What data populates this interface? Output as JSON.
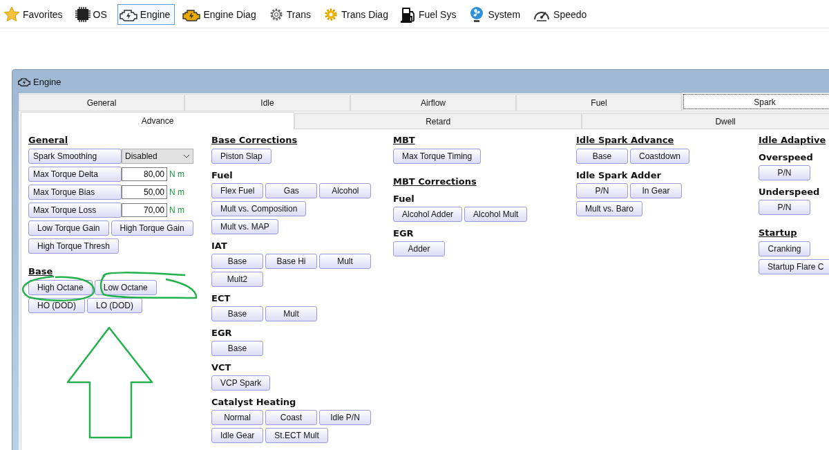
{
  "toolbar": [
    {
      "label": "Favorites",
      "selected": false
    },
    {
      "label": "OS",
      "selected": false
    },
    {
      "label": "Engine",
      "selected": true
    },
    {
      "label": "Engine Diag",
      "selected": false
    },
    {
      "label": "Trans",
      "selected": false
    },
    {
      "label": "Trans Diag",
      "selected": false
    },
    {
      "label": "Fuel Sys",
      "selected": false
    },
    {
      "label": "System",
      "selected": false
    },
    {
      "label": "Speedo",
      "selected": false
    }
  ],
  "window": {
    "title": "Engine"
  },
  "tabs": [
    {
      "label": "General",
      "selected": false
    },
    {
      "label": "Idle",
      "selected": false
    },
    {
      "label": "Airflow",
      "selected": false
    },
    {
      "label": "Fuel",
      "selected": false
    },
    {
      "label": "Spark",
      "selected": true
    }
  ],
  "subtabs": [
    {
      "label": "Advance",
      "selected": true
    },
    {
      "label": "Retard",
      "selected": false
    },
    {
      "label": "Dwell",
      "selected": false
    }
  ],
  "columns": [
    [
      {
        "kind": "section",
        "text": "General"
      },
      {
        "kind": "dropdown",
        "label": "Spark Smoothing",
        "value": "Disabled"
      },
      {
        "kind": "param",
        "label": "Max Torque Delta",
        "value": "80,00",
        "unit": "N m"
      },
      {
        "kind": "param",
        "label": "Max Torque Bias",
        "value": "50,00",
        "unit": "N m"
      },
      {
        "kind": "param",
        "label": "Max Torque Loss",
        "value": "70,00",
        "unit": "N m"
      },
      {
        "kind": "buttons",
        "labels": [
          "Low Torque Gain",
          "High Torque Gain"
        ]
      },
      {
        "kind": "buttons",
        "labels": [
          "High Torque Thresh"
        ]
      },
      {
        "kind": "section",
        "text": "Base"
      },
      {
        "kind": "buttons",
        "labels": [
          "High Octane",
          "Low Octane"
        ]
      },
      {
        "kind": "buttons",
        "labels": [
          "HO (DOD)",
          "LO (DOD)"
        ]
      }
    ],
    [
      {
        "kind": "section",
        "text": "Base Corrections"
      },
      {
        "kind": "buttons",
        "labels": [
          "Piston Slap"
        ]
      },
      {
        "kind": "group",
        "text": "Fuel"
      },
      {
        "kind": "buttons",
        "labels": [
          "Flex Fuel",
          "Gas",
          "Alcohol"
        ]
      },
      {
        "kind": "buttons",
        "labels": [
          "Mult vs. Composition"
        ]
      },
      {
        "kind": "buttons",
        "labels": [
          "Mult vs. MAP"
        ]
      },
      {
        "kind": "group",
        "text": "IAT"
      },
      {
        "kind": "buttons",
        "labels": [
          "Base",
          "Base Hi",
          "Mult"
        ]
      },
      {
        "kind": "buttons",
        "labels": [
          "Mult2"
        ]
      },
      {
        "kind": "group",
        "text": "ECT"
      },
      {
        "kind": "buttons",
        "labels": [
          "Base",
          "Mult"
        ]
      },
      {
        "kind": "group",
        "text": "EGR"
      },
      {
        "kind": "buttons",
        "labels": [
          "Base"
        ]
      },
      {
        "kind": "group",
        "text": "VCT"
      },
      {
        "kind": "buttons",
        "labels": [
          "VCP Spark"
        ]
      },
      {
        "kind": "group",
        "text": "Catalyst Heating"
      },
      {
        "kind": "buttons",
        "labels": [
          "Normal",
          "Coast",
          "Idle P/N"
        ]
      },
      {
        "kind": "buttons",
        "labels": [
          "Idle Gear",
          "St.ECT Mult"
        ]
      }
    ],
    [
      {
        "kind": "section",
        "text": "MBT"
      },
      {
        "kind": "buttons",
        "labels": [
          "Max Torque Timing"
        ]
      },
      {
        "kind": "section",
        "text": "MBT Corrections"
      },
      {
        "kind": "group",
        "text": "Fuel"
      },
      {
        "kind": "buttons",
        "labels": [
          "Alcohol Adder",
          "Alcohol Mult"
        ]
      },
      {
        "kind": "group",
        "text": "EGR"
      },
      {
        "kind": "buttons",
        "labels": [
          "Adder"
        ]
      }
    ],
    [
      {
        "kind": "section",
        "text": "Idle Spark Advance"
      },
      {
        "kind": "buttons",
        "labels": [
          "Base",
          "Coastdown"
        ]
      },
      {
        "kind": "group",
        "text": "Idle Spark Adder"
      },
      {
        "kind": "buttons",
        "labels": [
          "P/N",
          "In Gear"
        ]
      },
      {
        "kind": "buttons",
        "labels": [
          "Mult vs. Baro"
        ]
      }
    ],
    [
      {
        "kind": "section",
        "text": "Idle Adaptive"
      },
      {
        "kind": "group",
        "text": "Overspeed"
      },
      {
        "kind": "buttons",
        "labels": [
          "P/N"
        ]
      },
      {
        "kind": "group",
        "text": "Underspeed"
      },
      {
        "kind": "buttons",
        "labels": [
          "P/N"
        ]
      },
      {
        "kind": "section",
        "text": "Startup"
      },
      {
        "kind": "buttons",
        "labels": [
          "Cranking"
        ]
      },
      {
        "kind": "buttons",
        "labels": [
          "Startup Flare C"
        ]
      }
    ]
  ]
}
